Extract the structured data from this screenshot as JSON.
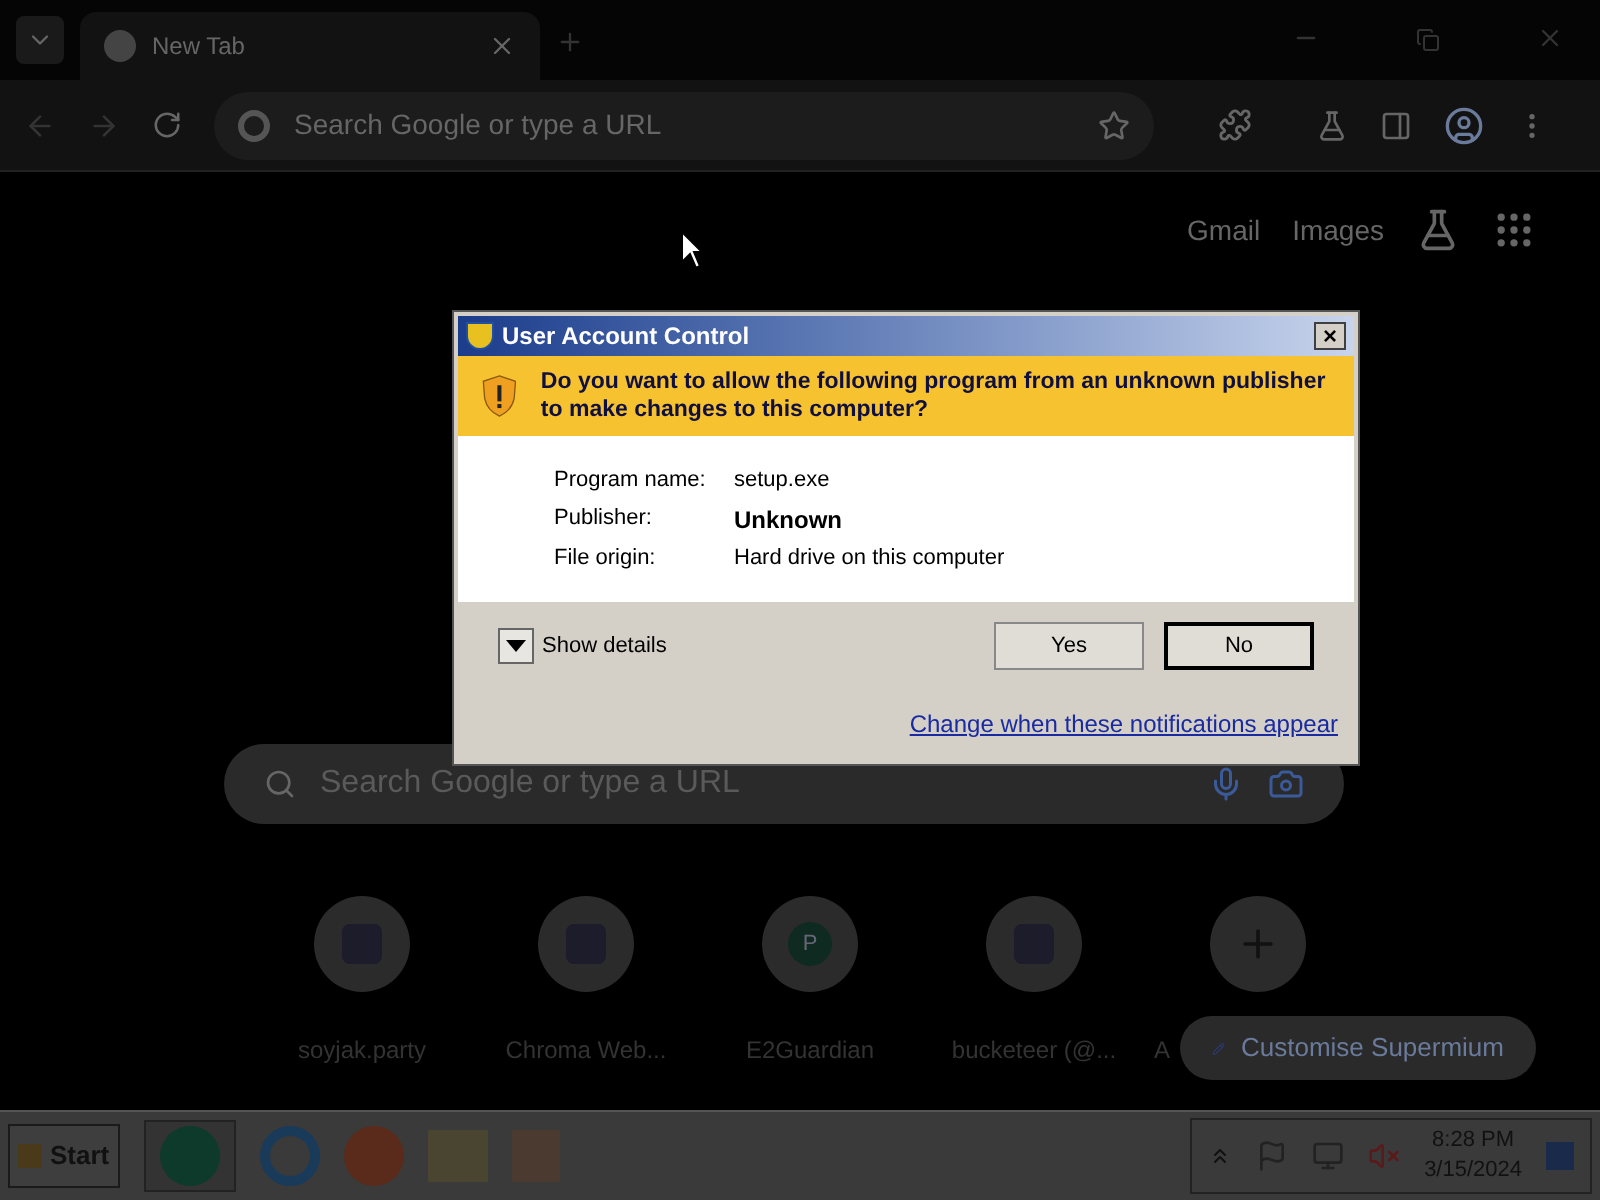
{
  "browser": {
    "tab": {
      "title": "New Tab",
      "selected": true
    },
    "address_placeholder": "Search Google or type a URL"
  },
  "new_tab": {
    "links": [
      "Gmail",
      "Images"
    ],
    "search_placeholder": "Search Google or type a URL",
    "shortcuts": [
      {
        "kind": "site",
        "label": "soyjak.party"
      },
      {
        "kind": "site",
        "label": "Chroma Web..."
      },
      {
        "kind": "letter",
        "label": "E2Guardian",
        "letter": "P"
      },
      {
        "kind": "site",
        "label": "bucketeer (@..."
      },
      {
        "kind": "add",
        "label": "A"
      }
    ],
    "customise_button": "Customise Supermium"
  },
  "dialog": {
    "title": "User Account Control",
    "close": "×",
    "question": "Do you want to allow the following program from an unknown publisher to make changes to this computer?",
    "fields": [
      {
        "label": "Program name:",
        "value": "setup.exe",
        "bold": false
      },
      {
        "label": "Publisher:",
        "value": "Unknown",
        "bold": true
      },
      {
        "label": "File origin:",
        "value": "Hard drive on this computer",
        "bold": false
      }
    ],
    "details": "Show details",
    "buttons": [
      {
        "label": "Yes",
        "selected": false
      },
      {
        "label": "No",
        "selected": true
      }
    ],
    "link": "Change when these notifications appear"
  },
  "taskbar": {
    "start": "Start",
    "time": "8:28 PM",
    "date": "3/15/2024"
  }
}
